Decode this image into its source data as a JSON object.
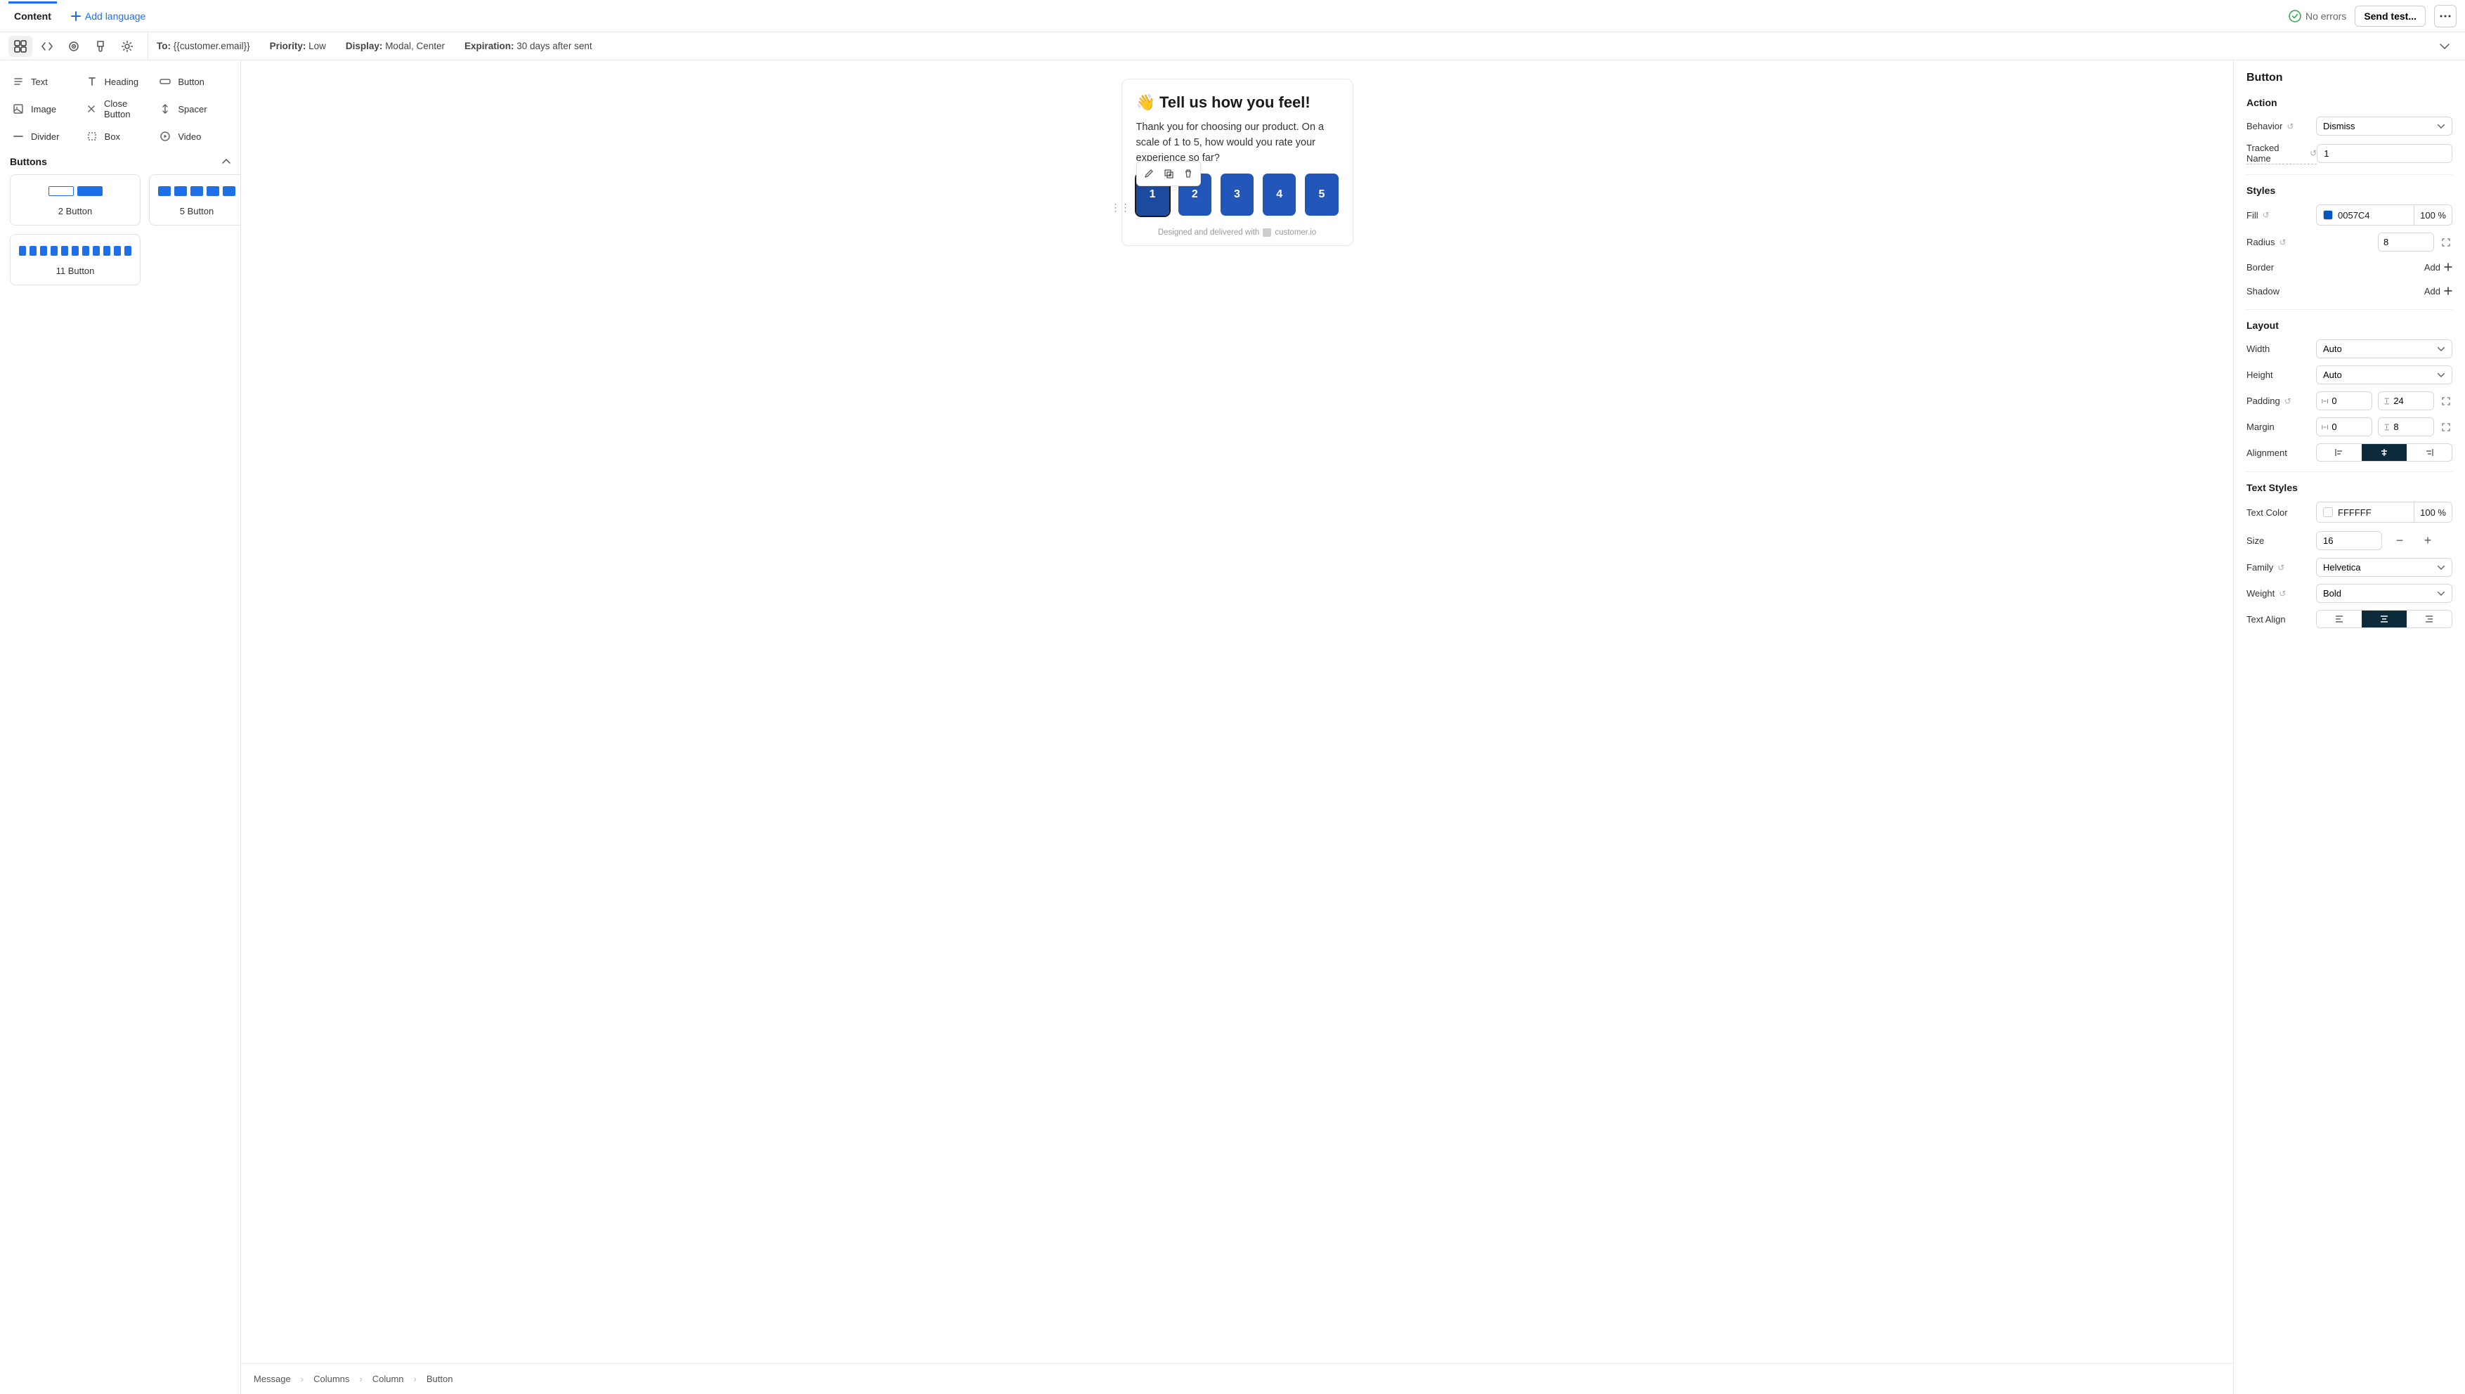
{
  "tabs": {
    "content": "Content",
    "add_language": "Add language"
  },
  "top_right": {
    "no_errors": "No errors",
    "send_test": "Send test..."
  },
  "meta": {
    "to_label": "To:",
    "to_value": "{{customer.email}}",
    "priority_label": "Priority:",
    "priority_value": "Low",
    "display_label": "Display:",
    "display_value": "Modal, Center",
    "expiration_label": "Expiration:",
    "expiration_value": "30 days after sent"
  },
  "components": {
    "text": "Text",
    "heading": "Heading",
    "button": "Button",
    "image": "Image",
    "close_button": "Close Button",
    "spacer": "Spacer",
    "divider": "Divider",
    "box": "Box",
    "video": "Video"
  },
  "buttons_section": {
    "title": "Buttons",
    "preset_2": "2 Button",
    "preset_5": "5 Button",
    "preset_11": "11 Button"
  },
  "modal": {
    "title": "👋 Tell us how you feel!",
    "body": "Thank you for choosing our product. On a scale of 1 to 5, how would you rate your experience so far?",
    "ratings": [
      "1",
      "2",
      "3",
      "4",
      "5"
    ],
    "footer": "Designed and delivered with",
    "footer_brand": "customer.io"
  },
  "breadcrumb": [
    "Message",
    "Columns",
    "Column",
    "Button"
  ],
  "right": {
    "title": "Button",
    "action": {
      "heading": "Action",
      "behavior_label": "Behavior",
      "behavior_value": "Dismiss",
      "tracked_label": "Tracked Name",
      "tracked_value": "1"
    },
    "styles": {
      "heading": "Styles",
      "fill_label": "Fill",
      "fill_value": "0057C4",
      "fill_pct": "100 %",
      "radius_label": "Radius",
      "radius_value": "8",
      "border_label": "Border",
      "border_add": "Add",
      "shadow_label": "Shadow",
      "shadow_add": "Add"
    },
    "layout": {
      "heading": "Layout",
      "width_label": "Width",
      "width_value": "Auto",
      "height_label": "Height",
      "height_value": "Auto",
      "padding_label": "Padding",
      "padding_h": "0",
      "padding_v": "24",
      "margin_label": "Margin",
      "margin_h": "0",
      "margin_v": "8",
      "alignment_label": "Alignment"
    },
    "text_styles": {
      "heading": "Text Styles",
      "text_color_label": "Text Color",
      "text_color_value": "FFFFFF",
      "text_color_pct": "100 %",
      "size_label": "Size",
      "size_value": "16",
      "family_label": "Family",
      "family_value": "Helvetica",
      "weight_label": "Weight",
      "weight_value": "Bold",
      "text_align_label": "Text Align"
    }
  }
}
